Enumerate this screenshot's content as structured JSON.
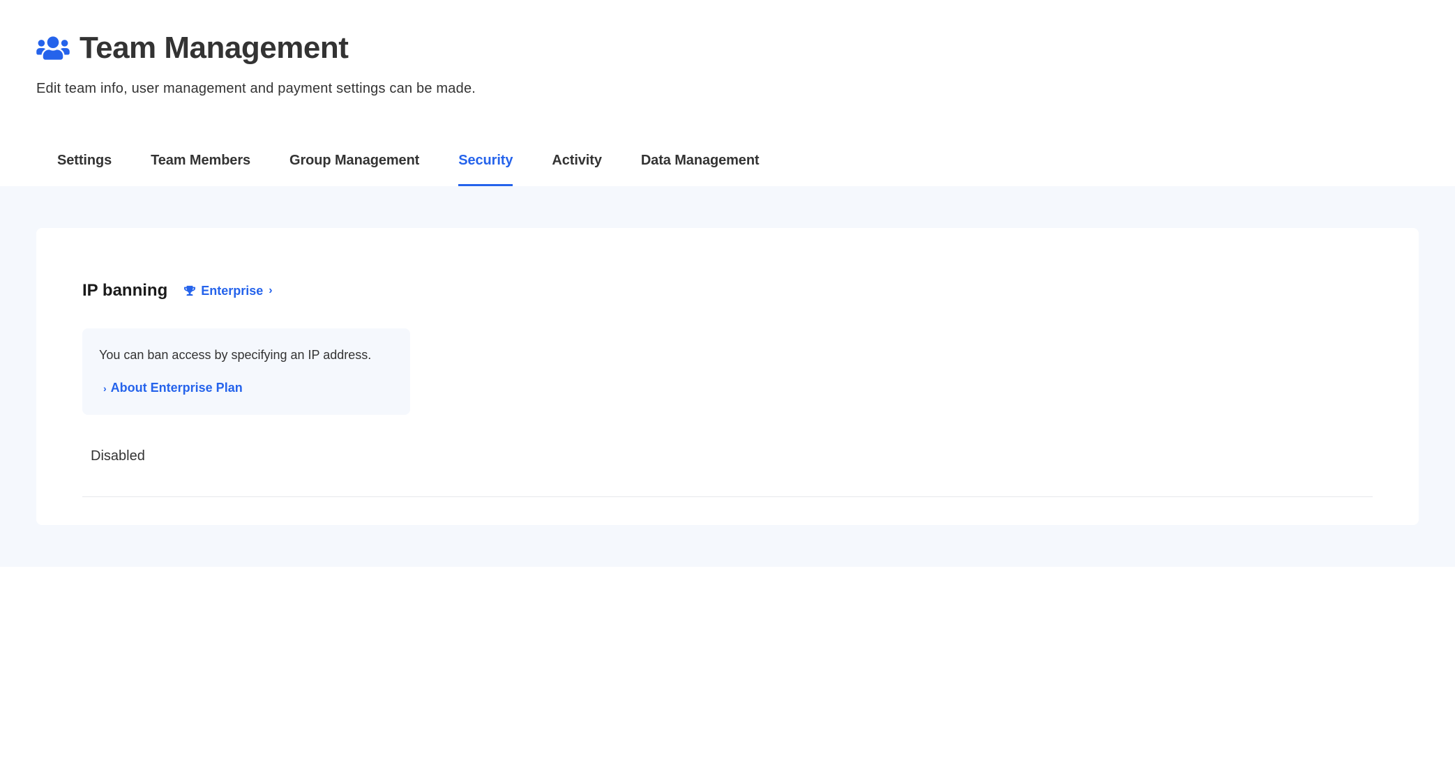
{
  "header": {
    "title": "Team Management",
    "description": "Edit team info, user management and payment settings can be made."
  },
  "tabs": [
    {
      "label": "Settings",
      "active": false
    },
    {
      "label": "Team Members",
      "active": false
    },
    {
      "label": "Group Management",
      "active": false
    },
    {
      "label": "Security",
      "active": true
    },
    {
      "label": "Activity",
      "active": false
    },
    {
      "label": "Data Management",
      "active": false
    }
  ],
  "section": {
    "title": "IP banning",
    "badge_label": "Enterprise",
    "info_text": "You can ban access by specifying an IP address.",
    "about_link": "About Enterprise Plan",
    "status": "Disabled"
  }
}
